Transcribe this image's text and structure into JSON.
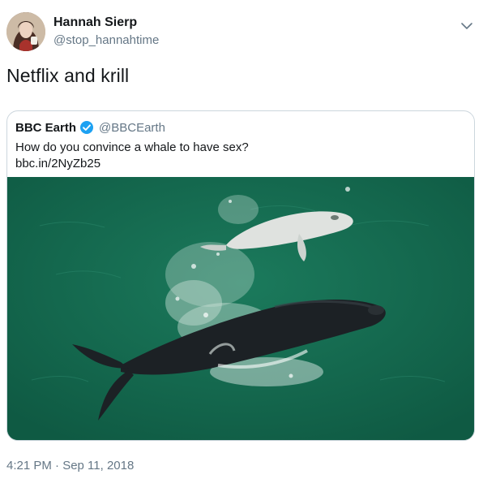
{
  "author": {
    "display_name": "Hannah Sierp",
    "username": "@stop_hannahtime",
    "avatar_icon": "user-avatar"
  },
  "tweet": {
    "text": "Netflix and krill",
    "timestamp": "4:21 PM · Sep 11, 2018",
    "menu_icon": "chevron-down-icon"
  },
  "quoted_tweet": {
    "display_name": "BBC Earth",
    "verified_icon": "verified-badge-icon",
    "username": "@BBCEarth",
    "text": "How do you convince a whale to have sex?",
    "link": "bbc.in/2NyZb25"
  },
  "colors": {
    "text_primary": "#14171a",
    "text_secondary": "#657786",
    "verified_blue": "#1da1f2",
    "border": "#ccd6dd",
    "ocean": "#16694f"
  }
}
